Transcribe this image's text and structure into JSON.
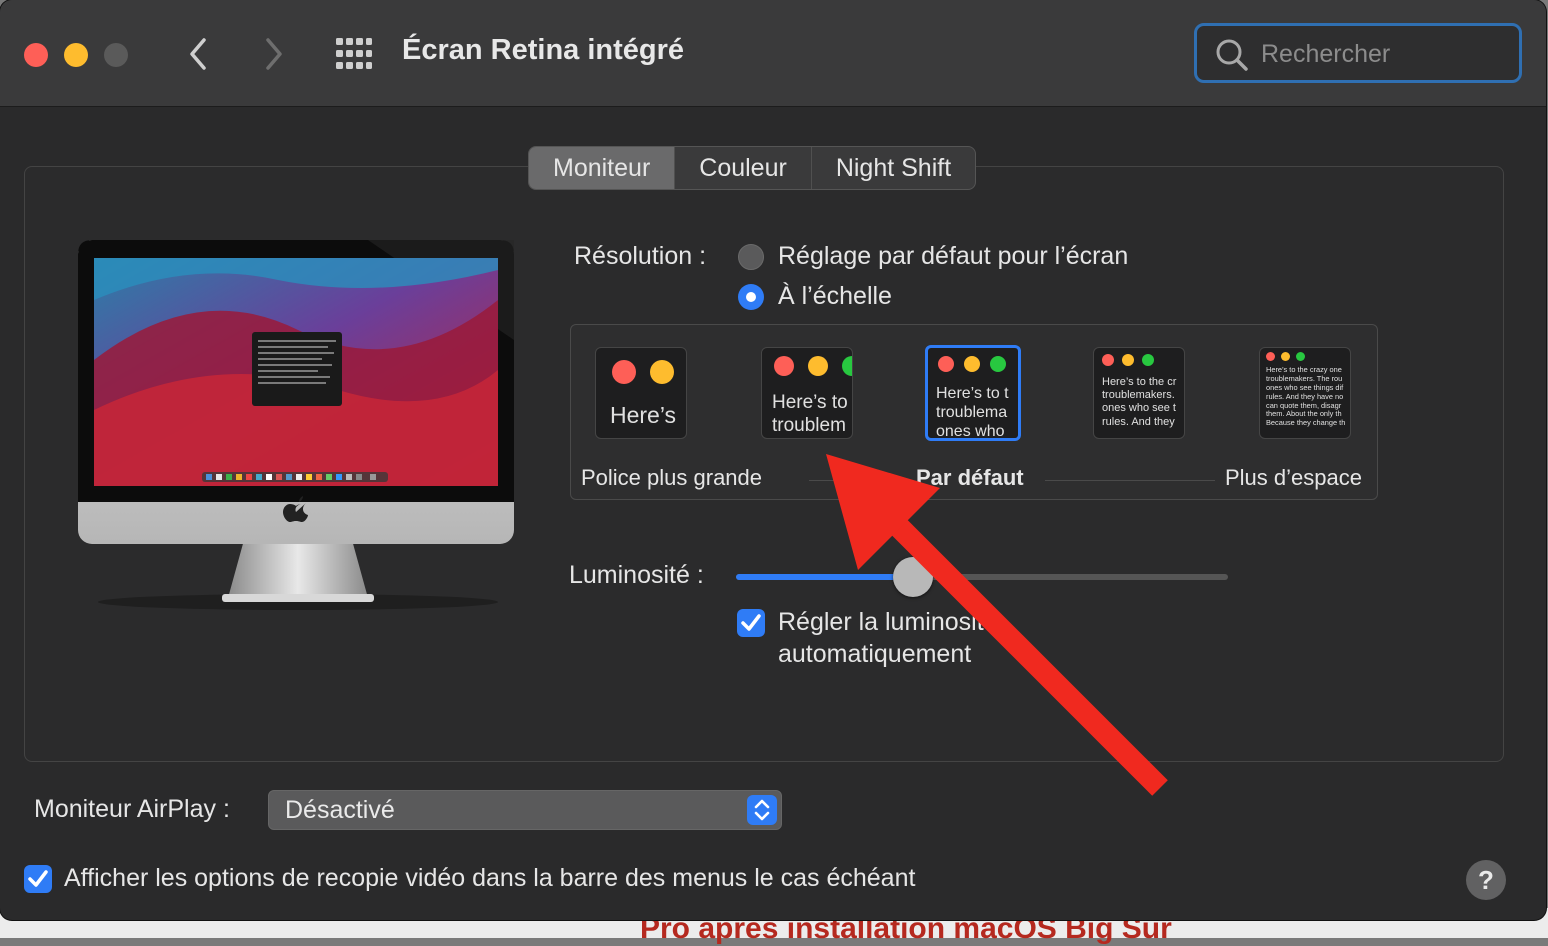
{
  "window": {
    "title": "Écran Retina intégré",
    "search_placeholder": "Rechercher"
  },
  "tabs": [
    {
      "label": "Moniteur",
      "active": true
    },
    {
      "label": "Couleur",
      "active": false
    },
    {
      "label": "Night Shift",
      "active": false
    }
  ],
  "resolution": {
    "label": "Résolution :",
    "options": [
      {
        "label": "Réglage par défaut pour l’écran",
        "selected": false
      },
      {
        "label": "À l’échelle",
        "selected": true
      }
    ],
    "scale_options": [
      {
        "sample_text": "Here’s",
        "selected": false
      },
      {
        "sample_text": "Here’s to\ntroublem",
        "selected": false
      },
      {
        "sample_text": "Here’s to t\ntroublema\nones who",
        "selected": true
      },
      {
        "sample_text": "Here’s to the cr\ntroublemakers.\nones who see t\nrules. And they",
        "selected": false
      },
      {
        "sample_text": "Here’s to the crazy one\ntroublemakers. The rou\nones who see things dif\nrules. And they have no\ncan quote them, disagr\nthem. About the only th\nBecause they change th",
        "selected": false
      }
    ],
    "caption_left": "Police plus grande",
    "caption_center": "Par défaut",
    "caption_right": "Plus d’espace"
  },
  "brightness": {
    "label": "Luminosité :",
    "level": 0.36,
    "auto_label_line1": "Régler la luminosité",
    "auto_label_line2": "automatiquement",
    "auto_checked": true
  },
  "airplay": {
    "label": "Moniteur AirPlay :",
    "value": "Désactivé"
  },
  "mirroring": {
    "label": "Afficher les options de recopie vidéo dans la barre des menus le cas échéant",
    "checked": true
  },
  "help": {
    "label": "?"
  },
  "background": {
    "partial_text": "Pro après installation macOS Big Sur"
  },
  "colors": {
    "accent": "#2f7cf6",
    "traffic_red": "#fe5f57",
    "traffic_yellow": "#febc2e",
    "traffic_green": "#28c840",
    "annotation_arrow": "#f0291f"
  }
}
